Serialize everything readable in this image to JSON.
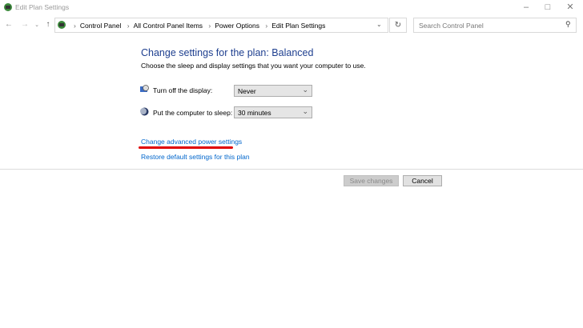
{
  "window": {
    "title": "Edit Plan Settings"
  },
  "breadcrumb": [
    "Control Panel",
    "All Control Panel Items",
    "Power Options",
    "Edit Plan Settings"
  ],
  "search": {
    "placeholder": "Search Control Panel"
  },
  "main": {
    "heading": "Change settings for the plan: Balanced",
    "subtitle": "Choose the sleep and display settings that you want your computer to use.",
    "display_label": "Turn off the display:",
    "display_value": "Never",
    "sleep_label": "Put the computer to sleep:",
    "sleep_value": "30 minutes",
    "advanced_link": "Change advanced power settings",
    "restore_link": "Restore default settings for this plan"
  },
  "buttons": {
    "save": "Save changes",
    "cancel": "Cancel"
  },
  "colors": {
    "heading": "#1e3f8f",
    "link": "#0066cc",
    "annotation": "#e00000"
  }
}
